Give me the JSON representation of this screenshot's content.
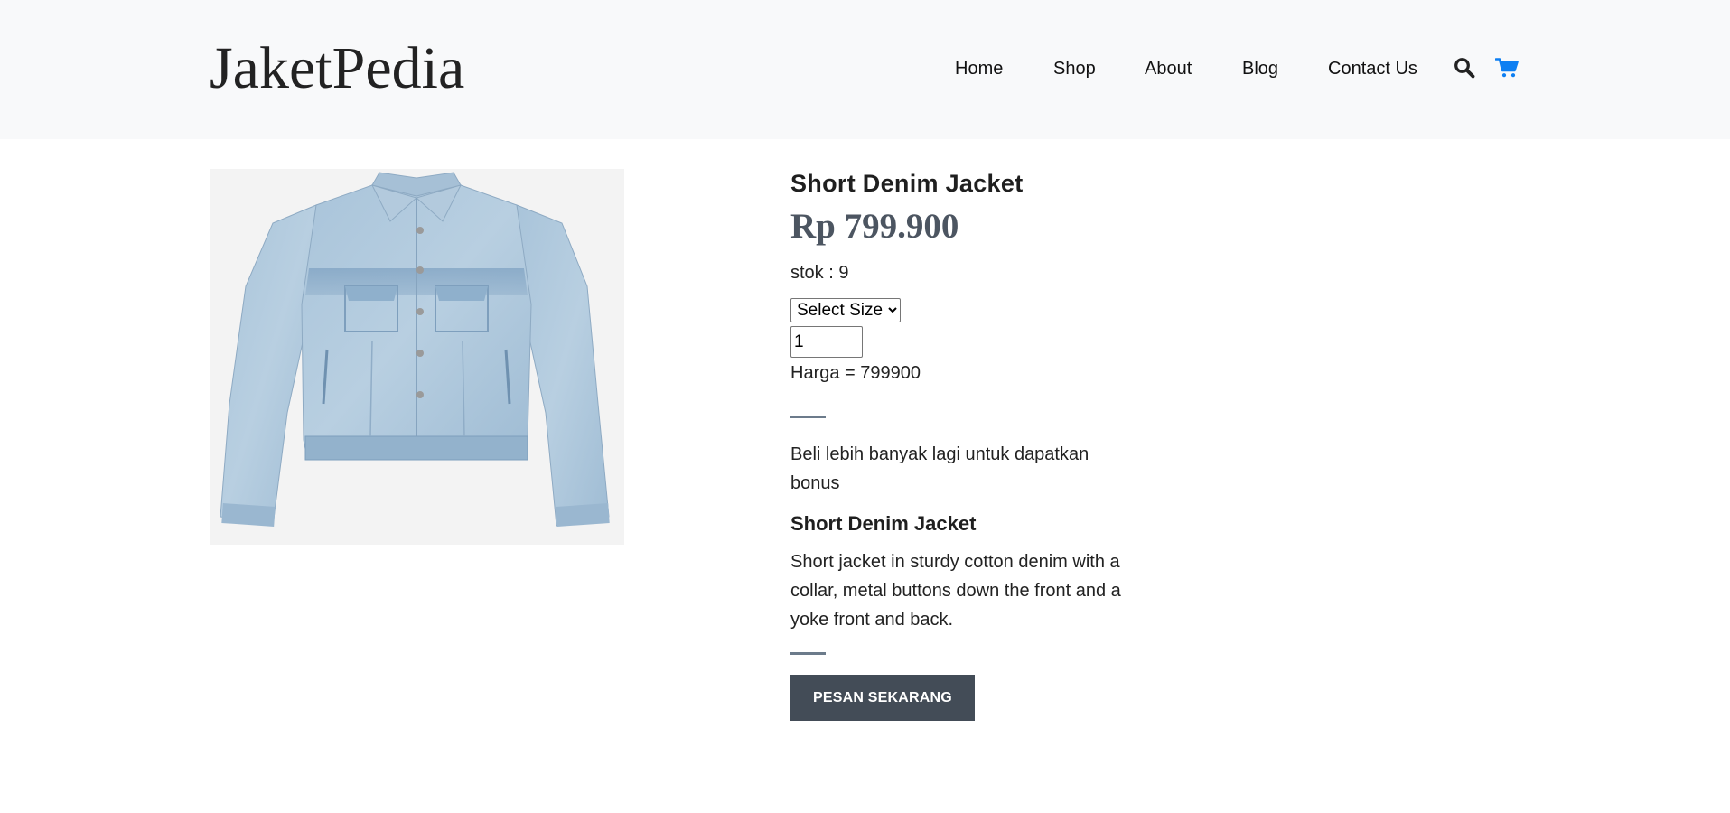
{
  "header": {
    "brand": "JaketPedia",
    "nav": [
      {
        "label": "Home"
      },
      {
        "label": "Shop"
      },
      {
        "label": "About"
      },
      {
        "label": "Blog"
      },
      {
        "label": "Contact Us"
      }
    ],
    "icons": {
      "search": "search-icon",
      "cart": "shopping-cart-icon"
    },
    "colors": {
      "background": "#f8f9fa",
      "cart_icon": "#0d7ff2"
    }
  },
  "product": {
    "image": "denim-jacket-photo",
    "title": "Short Denim Jacket",
    "price": "Rp 799.900",
    "stock_label": "stok : 9",
    "size_select": {
      "selected": "Select Size"
    },
    "quantity_value": "1",
    "harga_line": "Harga = 799900",
    "bonus_text": "Beli lebih banyak lagi untuk dapatkan bonus",
    "description_title": "Short Denim Jacket",
    "description": "Short jacket in sturdy cotton denim with a collar, metal buttons down the front and a yoke front and back.",
    "order_button": "PESAN SEKARANG",
    "colors": {
      "price": "#4c5561",
      "button": "#434c57",
      "divider": "#6c7b8b"
    }
  }
}
